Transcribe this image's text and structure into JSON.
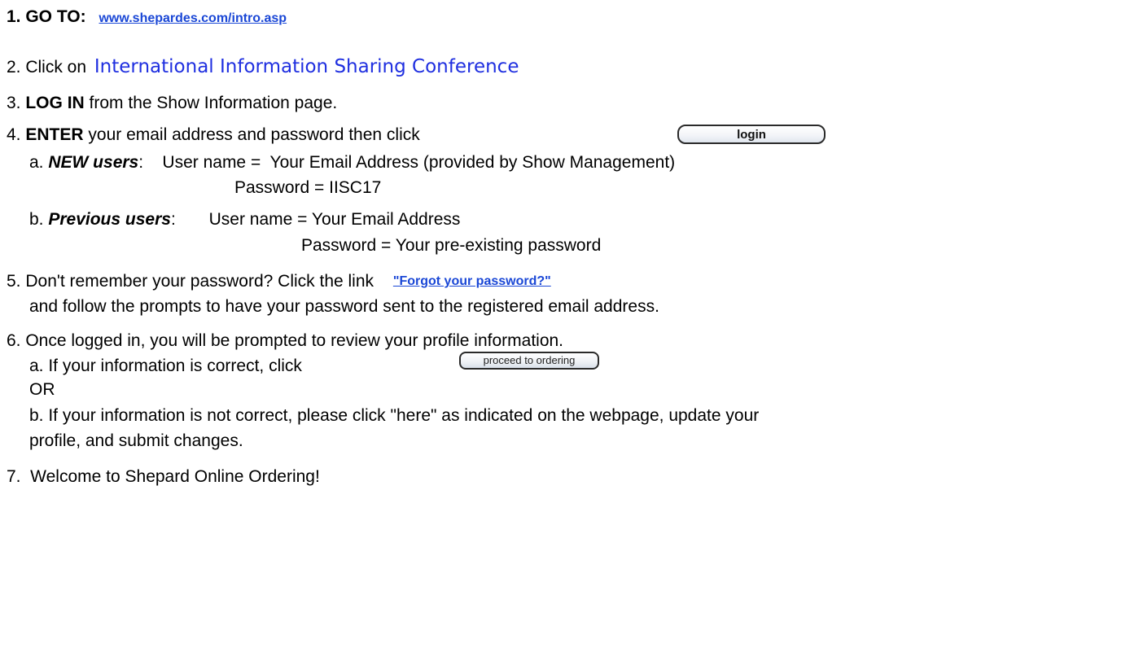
{
  "step1": {
    "prefix": "1. GO TO:",
    "link": "www.shepardes.com/intro.asp"
  },
  "step2": {
    "prefix": "2. Click on",
    "link": "International Information Sharing Conference"
  },
  "step3": {
    "num": "3.",
    "bold": "LOG IN",
    "rest": "from the Show Information page."
  },
  "step4": {
    "num": "4.",
    "bold": "ENTER",
    "rest": "your email address and password then click",
    "button": "login"
  },
  "step4a": {
    "num": "a.",
    "label": "NEW users",
    "line1": ":    User name =  Your Email Address (provided by Show Management)",
    "line2": "Password = IISC17"
  },
  "step4b": {
    "num": "b.",
    "label": "Previous users",
    "line1": ":       User name = Your Email Address",
    "line2": "Password = Your pre-existing password"
  },
  "step5": {
    "text": "5. Don't remember your password? Click the link",
    "link": "\"Forgot your password?\"",
    "line2": "and follow the prompts to have your password sent to the registered email address."
  },
  "step6": {
    "text": "6. Once logged in, you will be prompted to review your profile information.",
    "a": "a. If your information is correct, click",
    "button": "proceed to ordering",
    "or": "OR",
    "b1": "b. If your information is not correct, please click \"here\" as indicated on the webpage, update your",
    "b2": "profile, and submit changes."
  },
  "step7": {
    "text": "7.  Welcome to Shepard Online Ordering!"
  }
}
